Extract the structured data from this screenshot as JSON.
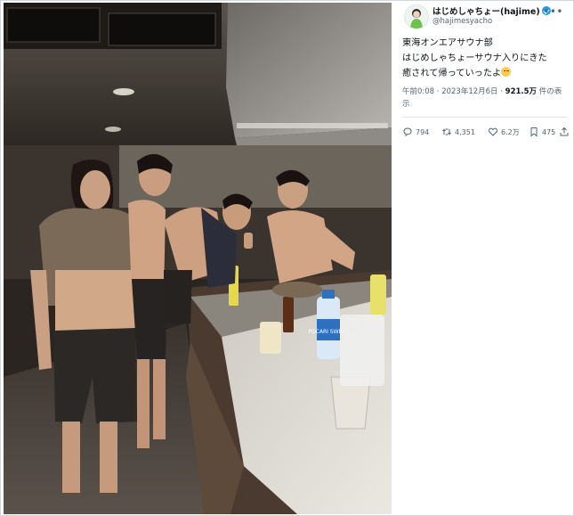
{
  "photo": {
    "alt_scene": "",
    "bottle_label": "POCARI SWEAT"
  },
  "tweet": {
    "display_name": "はじめしゃちょー(hajime)",
    "handle": "@hajimesyacho",
    "more_icon": "more-dots-icon",
    "text_lines": [
      "東海オンエアサウナ部",
      "はじめしゃちょーサウナ入りにきた",
      "癒されて帰っていったよ"
    ],
    "time": "午前0:08",
    "separator": "·",
    "date": "2023年12月6日",
    "views_count": "921.5万",
    "views_suffix": "件の表示"
  },
  "actions": {
    "reply_count": "794",
    "retweet_count": "4,351",
    "like_count": "6.2万",
    "bookmark_count": "475"
  },
  "colors": {
    "verified": "#1d9bf0",
    "muted": "#536471",
    "text": "#0f1419"
  }
}
